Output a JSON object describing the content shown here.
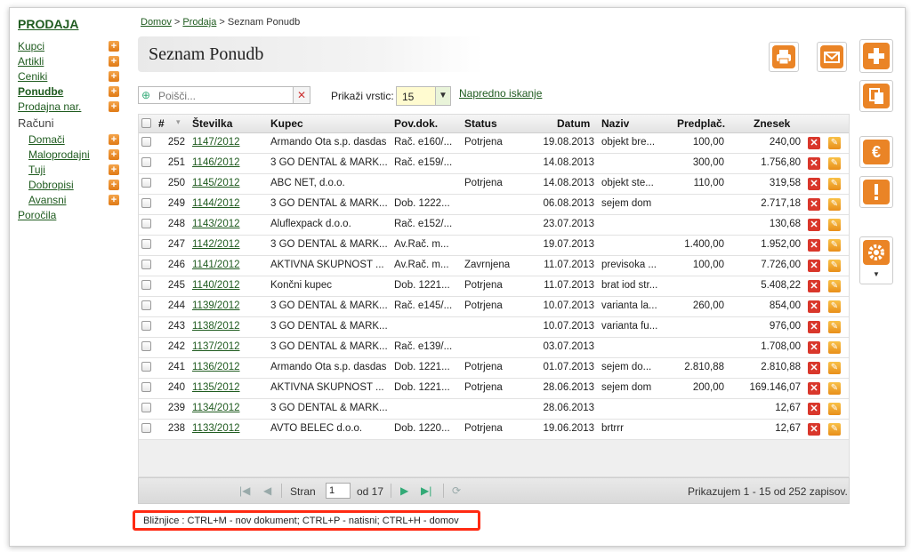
{
  "sidebar": {
    "title": "PRODAJA",
    "items": [
      {
        "label": "Kupci"
      },
      {
        "label": "Artikli"
      },
      {
        "label": "Ceniki"
      },
      {
        "label": "Ponudbe"
      },
      {
        "label": "Prodajna nar."
      }
    ],
    "racuni_label": "Računi",
    "sub_items": [
      {
        "label": "Domači"
      },
      {
        "label": "Maloprodajni"
      },
      {
        "label": "Tuji"
      },
      {
        "label": "Dobropisi"
      },
      {
        "label": "Avansni"
      }
    ],
    "porocila": "Poročila"
  },
  "breadcrumb": {
    "home": "Domov",
    "sep1": " > ",
    "section": "Prodaja",
    "sep2": " > ",
    "current": "Seznam Ponudb"
  },
  "page_title": "Seznam Ponudb",
  "toolbar": {
    "search_placeholder": "Poišči...",
    "rows_label": "Prikaži vrstic:",
    "rows_value": "15",
    "advanced_search": "Napredno iskanje"
  },
  "table": {
    "headers": [
      "#",
      "Številka",
      "Kupec",
      "Pov.dok.",
      "Status",
      "Datum",
      "Naziv",
      "Predplač.",
      "Znesek"
    ],
    "rows": [
      [
        "252",
        "1147/2012",
        "Armando Ota s.p. dasdas",
        "Rač. e160/...",
        "Potrjena",
        "19.08.2013",
        "objekt bre...",
        "100,00",
        "240,00"
      ],
      [
        "251",
        "1146/2012",
        "3 GO DENTAL & MARK...",
        "Rač. e159/...",
        "",
        "14.08.2013",
        "",
        "300,00",
        "1.756,80"
      ],
      [
        "250",
        "1145/2012",
        "ABC NET, d.o.o.",
        "",
        "Potrjena",
        "14.08.2013",
        "objekt ste...",
        "110,00",
        "319,58"
      ],
      [
        "249",
        "1144/2012",
        "3 GO DENTAL & MARK...",
        "Dob. 1222...",
        "",
        "06.08.2013",
        "sejem dom",
        "",
        "2.717,18"
      ],
      [
        "248",
        "1143/2012",
        "Aluflexpack d.o.o.",
        "Rač. e152/...",
        "",
        "23.07.2013",
        "",
        "",
        "130,68"
      ],
      [
        "247",
        "1142/2012",
        "3 GO DENTAL & MARK...",
        "Av.Rač. m...",
        "",
        "19.07.2013",
        "",
        "1.400,00",
        "1.952,00"
      ],
      [
        "246",
        "1141/2012",
        "AKTIVNA SKUPNOST ...",
        "Av.Rač. m...",
        "Zavrnjena",
        "11.07.2013",
        "previsoka ...",
        "100,00",
        "7.726,00"
      ],
      [
        "245",
        "1140/2012",
        "Končni kupec",
        "Dob. 1221...",
        "Potrjena",
        "11.07.2013",
        "brat iod str...",
        "",
        "5.408,22"
      ],
      [
        "244",
        "1139/2012",
        "3 GO DENTAL & MARK...",
        "Rač. e145/...",
        "Potrjena",
        "10.07.2013",
        "varianta la...",
        "260,00",
        "854,00"
      ],
      [
        "243",
        "1138/2012",
        "3 GO DENTAL & MARK...",
        "",
        "",
        "10.07.2013",
        "varianta fu...",
        "",
        "976,00"
      ],
      [
        "242",
        "1137/2012",
        "3 GO DENTAL & MARK...",
        "Rač. e139/...",
        "",
        "03.07.2013",
        "",
        "",
        "1.708,00"
      ],
      [
        "241",
        "1136/2012",
        "Armando Ota s.p. dasdas",
        "Dob. 1221...",
        "Potrjena",
        "01.07.2013",
        "sejem do...",
        "2.810,88",
        "2.810,88"
      ],
      [
        "240",
        "1135/2012",
        "AKTIVNA SKUPNOST ...",
        "Dob. 1221...",
        "Potrjena",
        "28.06.2013",
        "sejem dom",
        "200,00",
        "169.146,07"
      ],
      [
        "239",
        "1134/2012",
        "3 GO DENTAL & MARK...",
        "",
        "",
        "28.06.2013",
        "",
        "",
        "12,67"
      ],
      [
        "238",
        "1133/2012",
        "AVTO BELEC d.o.o.",
        "Dob. 1220...",
        "Potrjena",
        "19.06.2013",
        "brtrrr",
        "",
        "12,67"
      ]
    ]
  },
  "pager": {
    "page_label": "Stran",
    "page_value": "1",
    "of_label": "od 17",
    "summary": "Prikazujem 1 - 15 od 252 zapisov."
  },
  "shortcuts": "Bližnjice : CTRL+M - nov dokument; CTRL+P - natisni; CTRL+H - domov",
  "icons": [
    "print-icon",
    "mail-icon",
    "plus-icon",
    "copy-icon",
    "euro-icon",
    "warning-icon",
    "gear-icon"
  ],
  "colors": {
    "accent": "#e87e1f",
    "link": "#1f5b1f",
    "highlight": "#ff2a12"
  }
}
